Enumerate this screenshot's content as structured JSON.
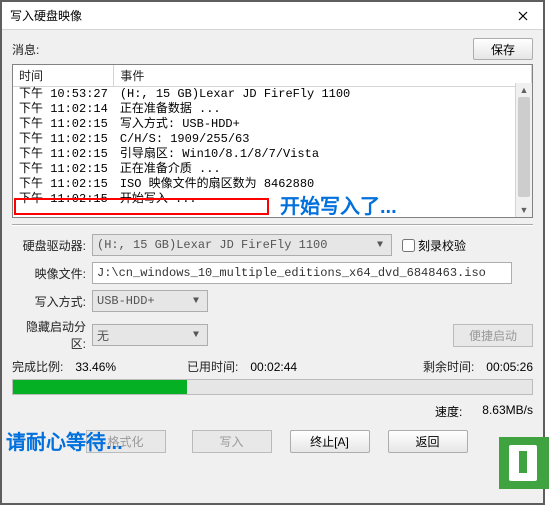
{
  "window": {
    "title": "写入硬盘映像"
  },
  "info": {
    "label": "消息:",
    "save_button": "保存"
  },
  "log": {
    "headers": {
      "time": "时间",
      "event": "事件"
    },
    "rows": [
      {
        "time": "下午 10:53:27",
        "event": "(H:, 15 GB)Lexar   JD FireFly     1100"
      },
      {
        "time": "下午 11:02:14",
        "event": "正在准备数据 ..."
      },
      {
        "time": "下午 11:02:15",
        "event": "写入方式: USB-HDD+"
      },
      {
        "time": "下午 11:02:15",
        "event": "C/H/S: 1909/255/63"
      },
      {
        "time": "下午 11:02:15",
        "event": "引导扇区: Win10/8.1/8/7/Vista"
      },
      {
        "time": "下午 11:02:15",
        "event": "正在准备介质 ..."
      },
      {
        "time": "下午 11:02:15",
        "event": "ISO 映像文件的扇区数为 8462880"
      },
      {
        "time": "下午 11:02:15",
        "event": "开始写入 ..."
      }
    ]
  },
  "form": {
    "drive_label": "硬盘驱动器:",
    "drive_value": "(H:, 15 GB)Lexar   JD FireFly     1100",
    "record_verify_label": "刻录校验",
    "image_label": "映像文件:",
    "image_value": "J:\\cn_windows_10_multiple_editions_x64_dvd_6848463.iso",
    "write_method_label": "写入方式:",
    "write_method_value": "USB-HDD+",
    "hidden_boot_label": "隐藏启动分区:",
    "hidden_boot_value": "无",
    "convenient_boot_button": "便捷启动"
  },
  "stats": {
    "percent_label": "完成比例:",
    "percent_value": "33.46%",
    "elapsed_label": "已用时间:",
    "elapsed_value": "00:02:44",
    "remain_label": "剩余时间:",
    "remain_value": "00:05:26",
    "progress_percent": 33.46,
    "speed_label": "速度:",
    "speed_value": "8.63MB/s"
  },
  "buttons": {
    "format": "格式化",
    "write": "写入",
    "stop": "终止[A]",
    "back": "返回"
  },
  "annotations": {
    "start_writing": "开始写入了...",
    "please_wait": "请耐心等待..."
  }
}
